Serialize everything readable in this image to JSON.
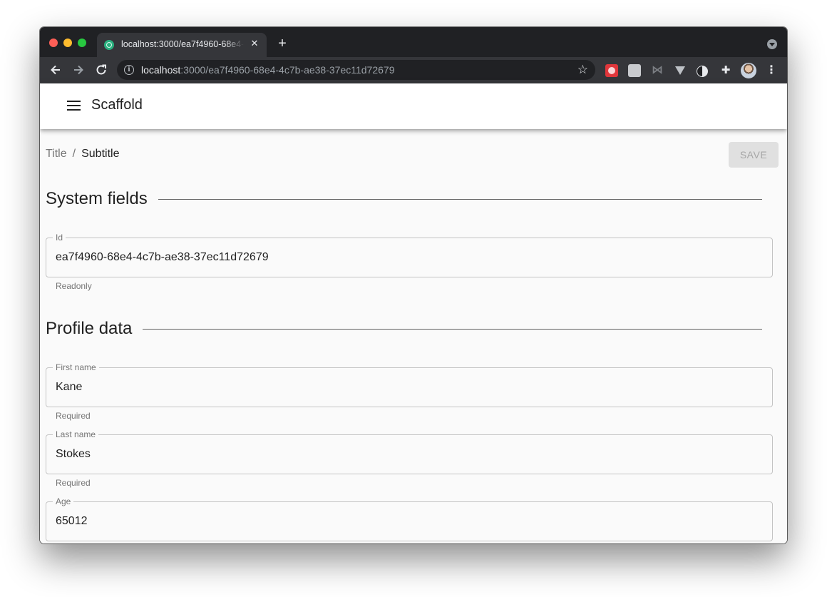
{
  "browser": {
    "tab_title": "localhost:3000/ea7f4960-68e4-4c7b-ae38-37ec11d72679",
    "url_host": "localhost",
    "url_path": ":3000/ea7f4960-68e4-4c7b-ae38-37ec11d72679"
  },
  "app": {
    "title": "Scaffold"
  },
  "breadcrumb": {
    "title": "Title",
    "separator": "/",
    "subtitle": "Subtitle"
  },
  "toolbar": {
    "save_label": "SAVE"
  },
  "sections": {
    "system": {
      "title": "System fields",
      "fields": [
        {
          "label": "Id",
          "value": "ea7f4960-68e4-4c7b-ae38-37ec11d72679",
          "helper": "Readonly"
        }
      ]
    },
    "profile": {
      "title": "Profile data",
      "fields": [
        {
          "label": "First name",
          "value": "Kane",
          "helper": "Required"
        },
        {
          "label": "Last name",
          "value": "Stokes",
          "helper": "Required"
        },
        {
          "label": "Age",
          "value": "65012",
          "helper": ""
        }
      ]
    }
  },
  "icons": {
    "traffic_lights": [
      "close",
      "minimize",
      "maximize"
    ],
    "nav": [
      "back-arrow-icon",
      "forward-arrow-icon",
      "reload-icon"
    ],
    "menu": "hamburger-menu-icon"
  },
  "colors": {
    "tabstrip": "#202124",
    "toolbar": "#35363a",
    "app_bar": "#ffffff",
    "page_bg": "#fafafa",
    "save_disabled_bg": "#e0e0e0"
  }
}
